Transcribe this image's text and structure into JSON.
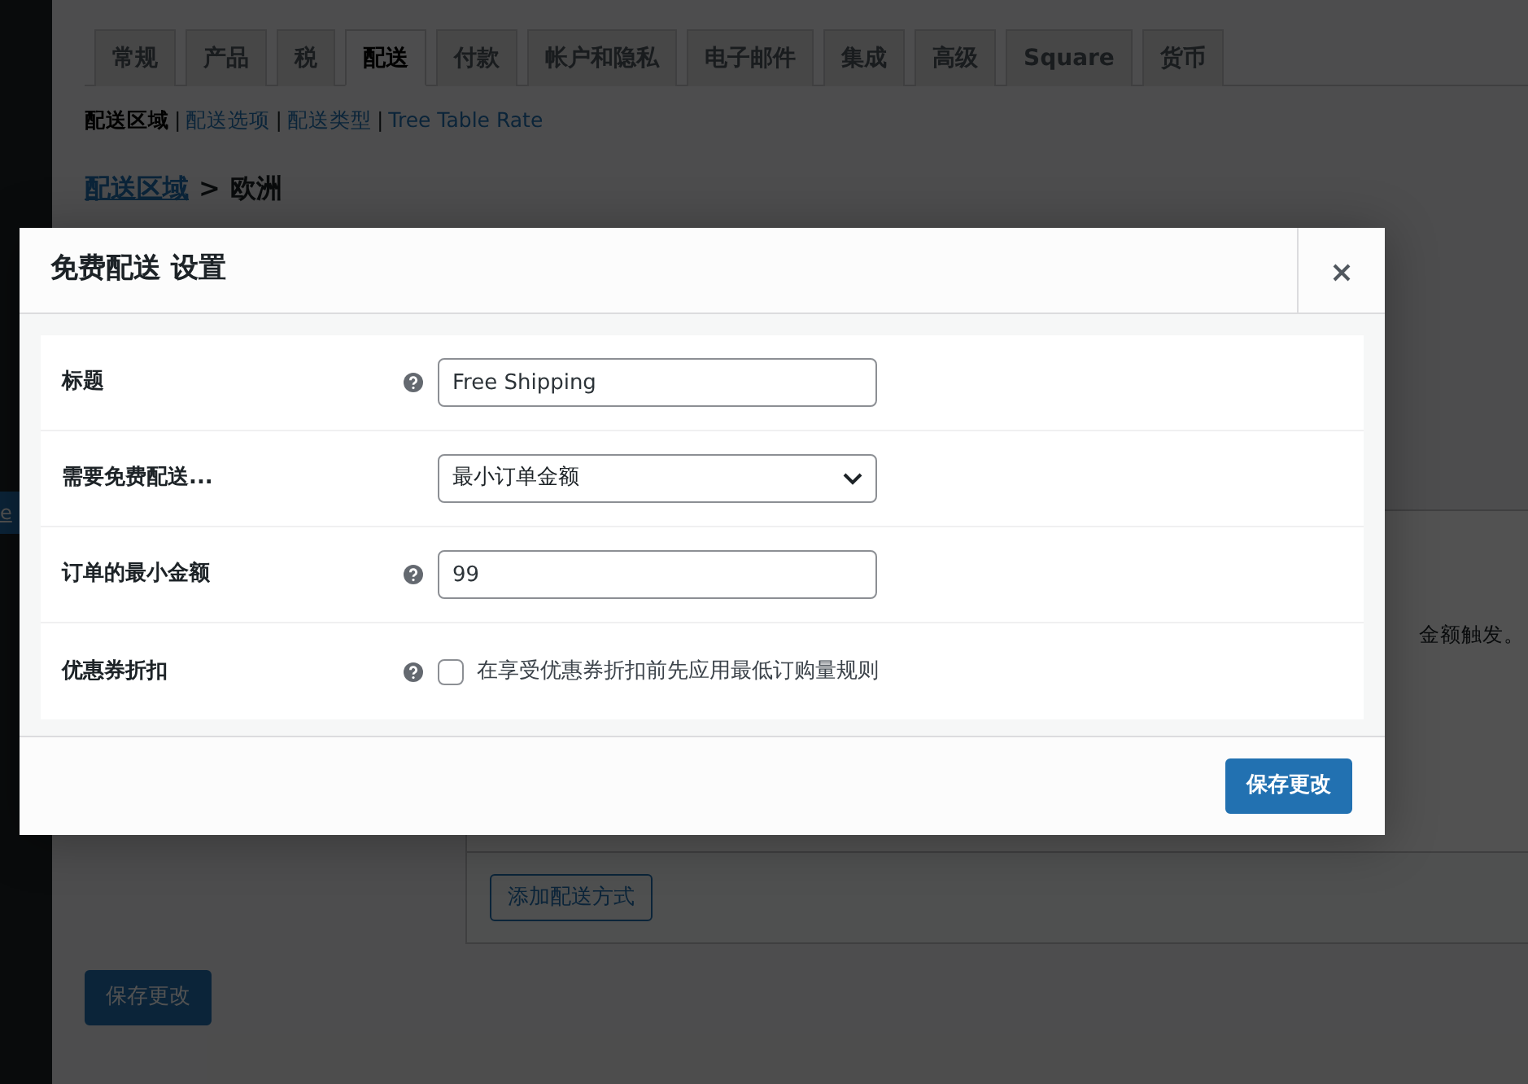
{
  "sidebar": {
    "items": [
      {
        "label": "e",
        "selected": true
      }
    ]
  },
  "tabs": [
    {
      "label": "常规",
      "selected": false
    },
    {
      "label": "产品",
      "selected": false
    },
    {
      "label": "税",
      "selected": false
    },
    {
      "label": "配送",
      "selected": true
    },
    {
      "label": "付款",
      "selected": false
    },
    {
      "label": "帐户和隐私",
      "selected": false
    },
    {
      "label": "电子邮件",
      "selected": false
    },
    {
      "label": "集成",
      "selected": false
    },
    {
      "label": "高级",
      "selected": false
    },
    {
      "label": "Square",
      "selected": false
    },
    {
      "label": "货币",
      "selected": false
    }
  ],
  "subnav": [
    {
      "label": "配送区域",
      "selected": true
    },
    {
      "separator": "|",
      "label": "配送选项",
      "selected": false
    },
    {
      "separator": "|",
      "label": "配送类型",
      "selected": false
    },
    {
      "separator": "|",
      "label": "Tree Table Rate",
      "selected": false
    }
  ],
  "breadcrumb": {
    "link": "配送区域",
    "separator": ">",
    "current": "欧洲"
  },
  "zone_panel": {
    "description": "金额触发。",
    "add_button": "添加配送方式"
  },
  "save_button": "保存更改",
  "modal": {
    "title": "免费配送 设置",
    "fields": [
      {
        "kind": "text",
        "label": "标题",
        "help": true,
        "value": "Free Shipping"
      },
      {
        "kind": "select",
        "label": "需要免费配送...",
        "help": false,
        "value": "最小订单金额"
      },
      {
        "kind": "text",
        "label": "订单的最小金额",
        "help": true,
        "value": "99"
      },
      {
        "kind": "checkbox",
        "label": "优惠券折扣",
        "help": true,
        "checked": false,
        "text": "在享受优惠券折扣前先应用最低订购量规则"
      }
    ],
    "save_button": "保存更改"
  }
}
